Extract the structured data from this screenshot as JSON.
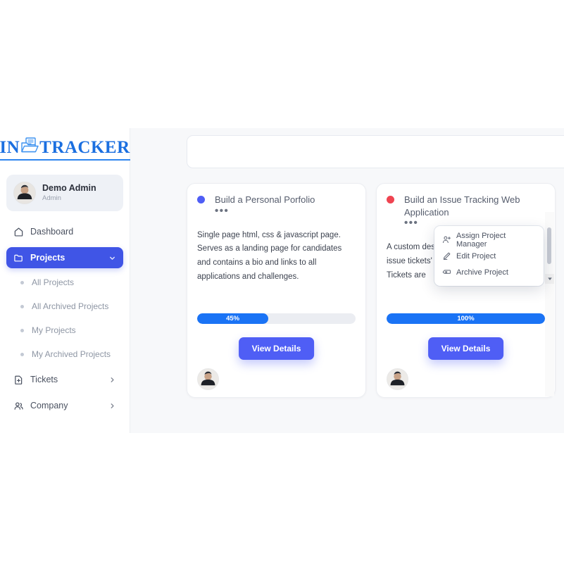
{
  "brand": {
    "name_left": "IN",
    "name_right": "TRACKER",
    "logo_icon": "folder-document-icon",
    "color": "#1b6fe0"
  },
  "sidebar": {
    "profile": {
      "name": "Demo Admin",
      "role": "Admin",
      "avatar_icon": "user-avatar-photo"
    },
    "items": [
      {
        "label": "Dashboard",
        "icon": "home-icon",
        "active": false,
        "chevron": ""
      },
      {
        "label": "Projects",
        "icon": "folder-icon",
        "active": true,
        "chevron": "chevron-down-icon"
      },
      {
        "label": "Tickets",
        "icon": "ticket-document-icon",
        "active": false,
        "chevron": "chevron-right-icon"
      },
      {
        "label": "Company",
        "icon": "people-icon",
        "active": false,
        "chevron": "chevron-right-icon"
      }
    ],
    "subitems": [
      {
        "label": "All Projects"
      },
      {
        "label": "All Archived Projects"
      },
      {
        "label": "My Projects"
      },
      {
        "label": "My Archived Projects"
      }
    ],
    "active_color": "#4055e6"
  },
  "main": {
    "topbar": {
      "content": ""
    },
    "cards": [
      {
        "title": "Build a Personal Porfolio",
        "status_color": "#4f5ef5",
        "kebab": "•••",
        "description": "Single page html, css & javascript page. Serves as a landing page for candidates and contains a bio and links to all applications and challenges.",
        "progress": "45%",
        "progress_value": 45,
        "button_label": "View Details",
        "avatar_icon": "user-avatar-photo"
      },
      {
        "title": "Build an Issue Tracking Web Application",
        "status_color": "#ef4451",
        "kebab": "•••",
        "description": "A custom desi with postgres multi tennent issue tickets' p identity and user roles. Tickets are",
        "progress": "100%",
        "progress_value": 100,
        "button_label": "View Details",
        "avatar_icon": "user-avatar-photo"
      }
    ],
    "context_menu": {
      "items": [
        {
          "label": "Assign Project Manager",
          "icon": "user-plus-icon"
        },
        {
          "label": "Edit Project",
          "icon": "pencil-icon"
        },
        {
          "label": "Archive Project",
          "icon": "archive-box-icon"
        }
      ]
    }
  }
}
